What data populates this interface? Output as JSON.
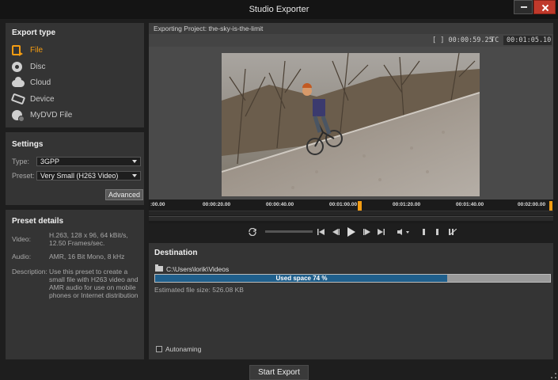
{
  "window": {
    "title": "Studio Exporter"
  },
  "export_type": {
    "heading": "Export type",
    "items": [
      {
        "label": "File",
        "icon": "file-export-icon",
        "active": true
      },
      {
        "label": "Disc",
        "icon": "disc-icon",
        "active": false
      },
      {
        "label": "Cloud",
        "icon": "cloud-icon",
        "active": false
      },
      {
        "label": "Device",
        "icon": "device-icon",
        "active": false
      },
      {
        "label": "MyDVD File",
        "icon": "mydvd-icon",
        "active": false
      }
    ]
  },
  "settings": {
    "heading": "Settings",
    "type_label": "Type:",
    "type_value": "3GPP",
    "preset_label": "Preset:",
    "preset_value": "Very Small (H263 Video)",
    "advanced_label": "Advanced"
  },
  "preset_details": {
    "heading": "Preset details",
    "video_label": "Video:",
    "video_value": "H.263, 128 x 96, 64 kBit/s, 12.50 Frames/sec.",
    "audio_label": "Audio:",
    "audio_value": "AMR, 16 Bit Mono, 8 kHz",
    "description_label": "Description:",
    "description_value": "Use this preset to create a small file with H263 video and AMR audio for use on mobile phones or Internet distribution"
  },
  "preview": {
    "project_label": "Exporting Project: the-sky-is-the-limit",
    "duration": "[ ] 00:00:59.25",
    "tc_label": "TC",
    "timecode": "00:01:05.10"
  },
  "timeline": {
    "labels": [
      ":00.00",
      "00:00:20.00",
      "00:00:40.00",
      "00:01:00.00",
      "00:01:20.00",
      "00:01:40.00",
      "00:02:00.00"
    ]
  },
  "destination": {
    "heading": "Destination",
    "path": "C:\\Users\\lorik\\Videos",
    "used_space_label": "Used space 74 %",
    "used_space_fraction": 0.74,
    "estimated_size": "Estimated file size: 526.08 KB",
    "autonaming_label": "Autonaming",
    "autonaming_checked": false
  },
  "footer": {
    "start_export_label": "Start Export"
  },
  "colors": {
    "accent": "#f39c12",
    "space_fill": "#1f5f8c",
    "panel": "#343434",
    "background": "#1e1e1e"
  }
}
